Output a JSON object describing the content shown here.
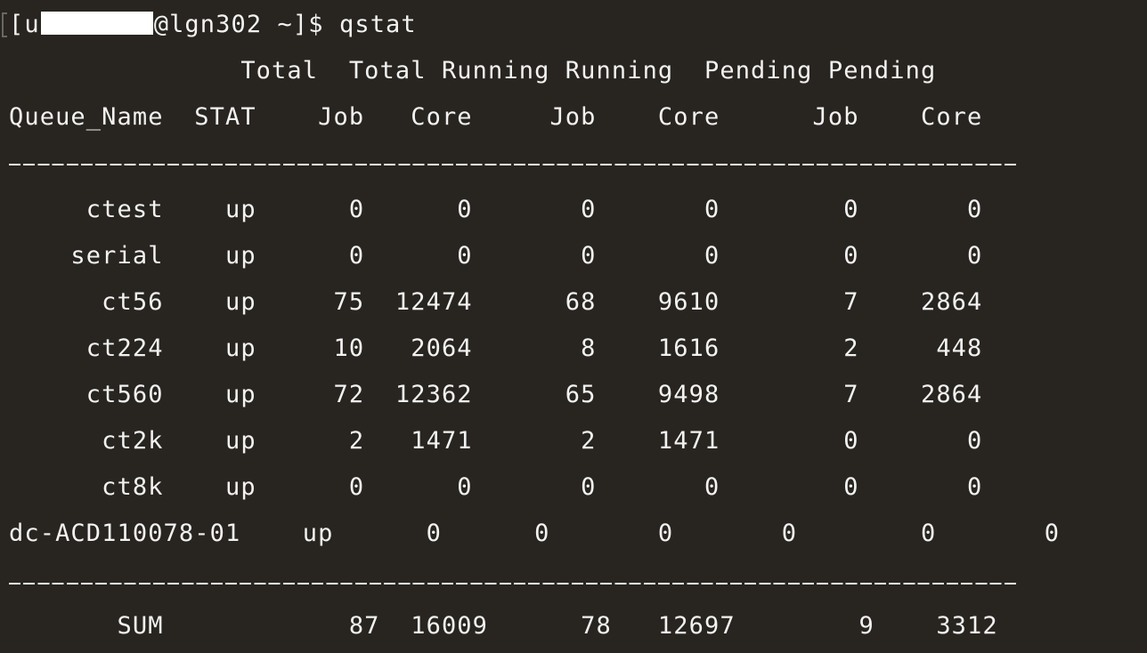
{
  "terminal": {
    "prompt_prefix": "[u",
    "prompt_suffix": "@lgn302 ~]$ ",
    "command": "qstat"
  },
  "header_row1": "               Total  Total Running Running  Pending Pending",
  "header_row2": "Queue_Name  STAT    Job   Core     Job    Core      Job    Core",
  "rows": [
    "     ctest    up      0      0       0       0        0       0",
    "    serial    up      0      0       0       0        0       0",
    "      ct56    up     75  12474      68    9610        7    2864",
    "     ct224    up     10   2064       8    1616        2     448",
    "     ct560    up     72  12362      65    9498        7    2864",
    "      ct2k    up      2   1471       2    1471        0       0",
    "      ct8k    up      0      0       0       0        0       0",
    "dc-ACD110078-01    up      0      0       0       0        0       0"
  ],
  "sum_row": "       SUM            87  16009      78   12697        9    3312"
}
